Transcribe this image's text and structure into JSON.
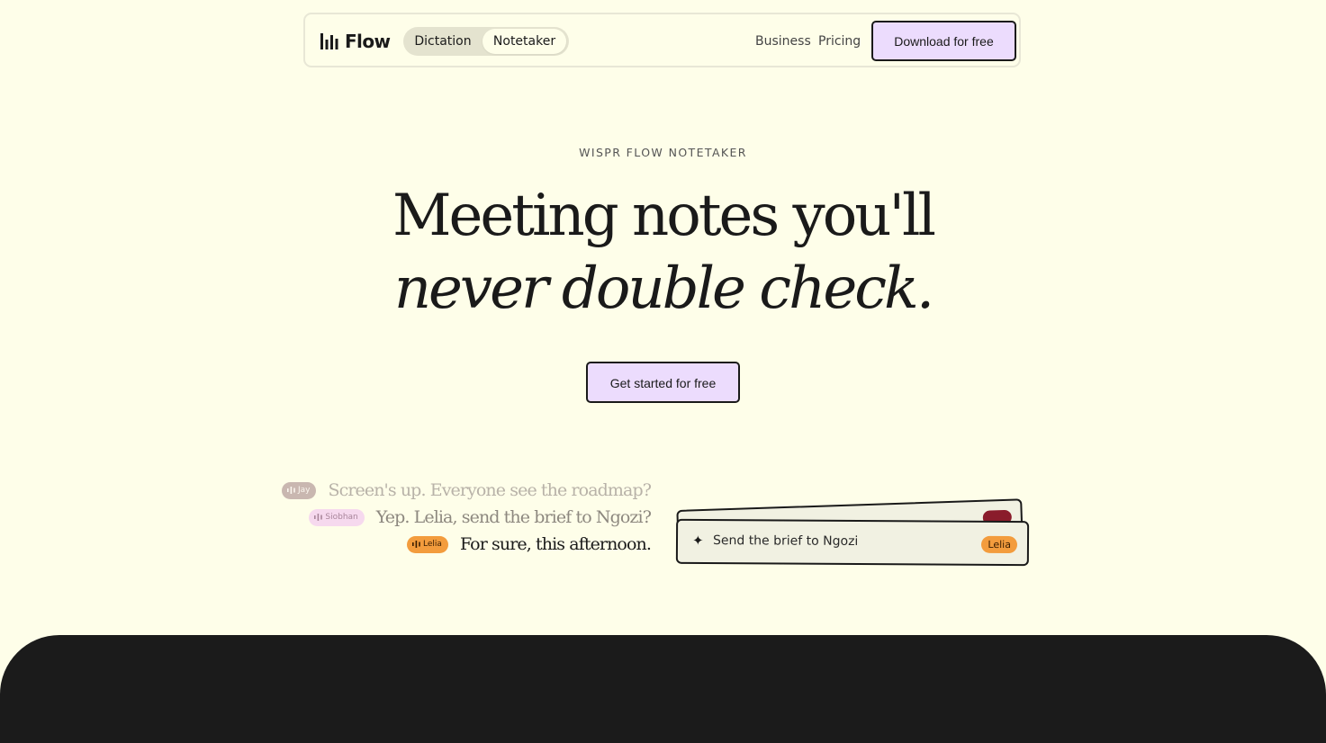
{
  "nav": {
    "logo_text": "Flow",
    "logo_icon": "waveform-bars-icon",
    "tabs": [
      {
        "label": "Dictation",
        "selected": false
      },
      {
        "label": "Notetaker",
        "selected": true
      }
    ],
    "links": [
      "Business",
      "Pricing"
    ],
    "download_label": "Download for free"
  },
  "hero": {
    "eyebrow": "WISPR FLOW NOTETAKER",
    "headline_line1": "Meeting notes you'll",
    "headline_line2": "never double check.",
    "cta_label": "Get started for free"
  },
  "transcript": [
    {
      "speaker": "Jay",
      "text": "Screen's up. Everyone see the roadmap?"
    },
    {
      "speaker": "Siobhan",
      "text": "Yep. Lelia, send the brief to Ngozi?"
    },
    {
      "speaker": "Lelia",
      "text": "For sure, this afternoon."
    }
  ],
  "task_card": {
    "icon": "sparkle-icon",
    "text": "Send the brief to Ngozi",
    "assignee": "Lelia"
  },
  "colors": {
    "background": "#fefee9",
    "accent_lavender": "#ecdcfd",
    "ink": "#1a1a1a",
    "lelia_orange": "#f39c3d",
    "siobhan_pink": "#f6d9ee",
    "jay_taupe": "#c9b7b0",
    "dark_section": "#1b1b1b"
  }
}
